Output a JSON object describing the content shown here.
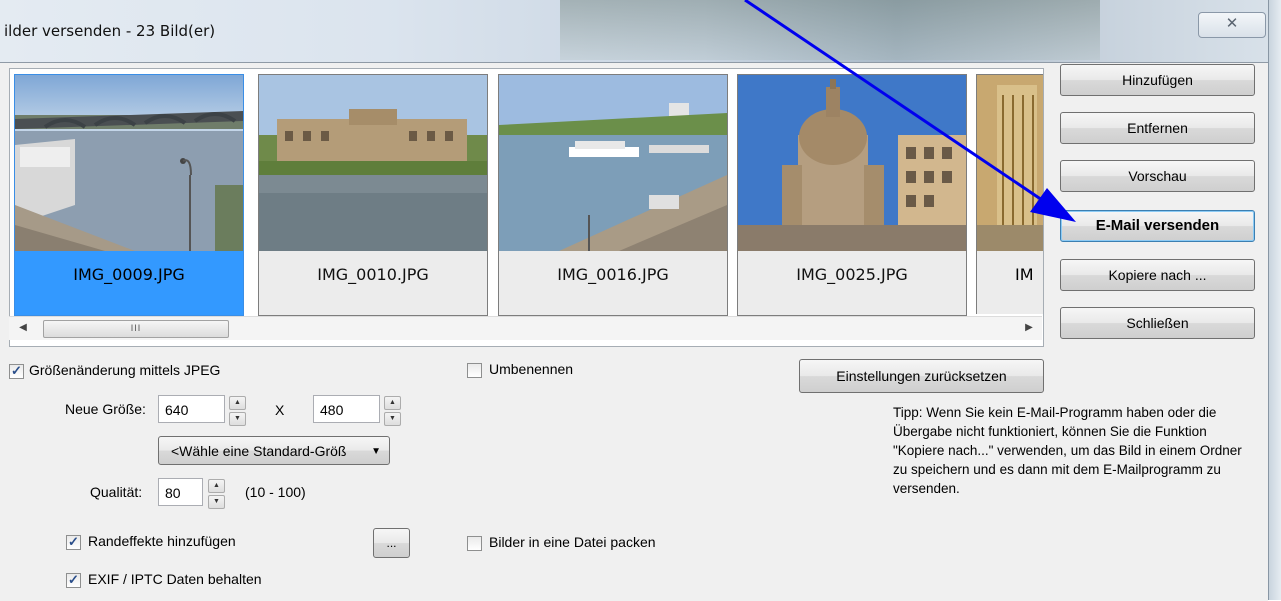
{
  "window": {
    "title": "ilder versenden - 23 Bild(er)",
    "close_glyph": "✕"
  },
  "thumbnails": [
    {
      "filename": "IMG_0009.JPG",
      "selected": true
    },
    {
      "filename": "IMG_0010.JPG",
      "selected": false
    },
    {
      "filename": "IMG_0016.JPG",
      "selected": false
    },
    {
      "filename": "IMG_0025.JPG",
      "selected": false
    },
    {
      "filename": "IM",
      "selected": false
    }
  ],
  "scrollbar": {
    "left_arrow": "◀",
    "right_arrow": "▶",
    "grip": "III"
  },
  "side_buttons": {
    "add": "Hinzufügen",
    "remove": "Entfernen",
    "preview": "Vorschau",
    "send_email": "E-Mail versenden",
    "copy_to": "Kopiere nach ...",
    "close": "Schließen"
  },
  "options": {
    "resize_jpeg": {
      "label": "Größenänderung mittels JPEG",
      "checked": true
    },
    "rename": {
      "label": "Umbenennen",
      "checked": false
    },
    "reset_settings": "Einstellungen zurücksetzen",
    "new_size_label": "Neue Größe:",
    "width": "640",
    "times": "X",
    "height": "480",
    "standard_size": "<Wähle eine Standard-Größ",
    "quality_label": "Qualität:",
    "quality": "80",
    "quality_range": "(10 - 100)",
    "border_effects": {
      "label": "Randeffekte hinzufügen",
      "checked": true
    },
    "ellipsis": "...",
    "pack_images": {
      "label": "Bilder in eine Datei packen",
      "checked": false
    },
    "keep_exif": {
      "label": "EXIF / IPTC Daten behalten",
      "checked": true
    }
  },
  "tip": "Tipp: Wenn Sie kein E-Mail-Programm haben oder die Übergabe nicht funktioniert, können Sie die Funktion \"Kopiere nach...\" verwenden, um das Bild in einem Ordner zu speichern und es dann mit dem E-Mailprogramm zu versenden.",
  "colors": {
    "selection": "#3399ff",
    "annotation_arrow": "#0000ee"
  }
}
